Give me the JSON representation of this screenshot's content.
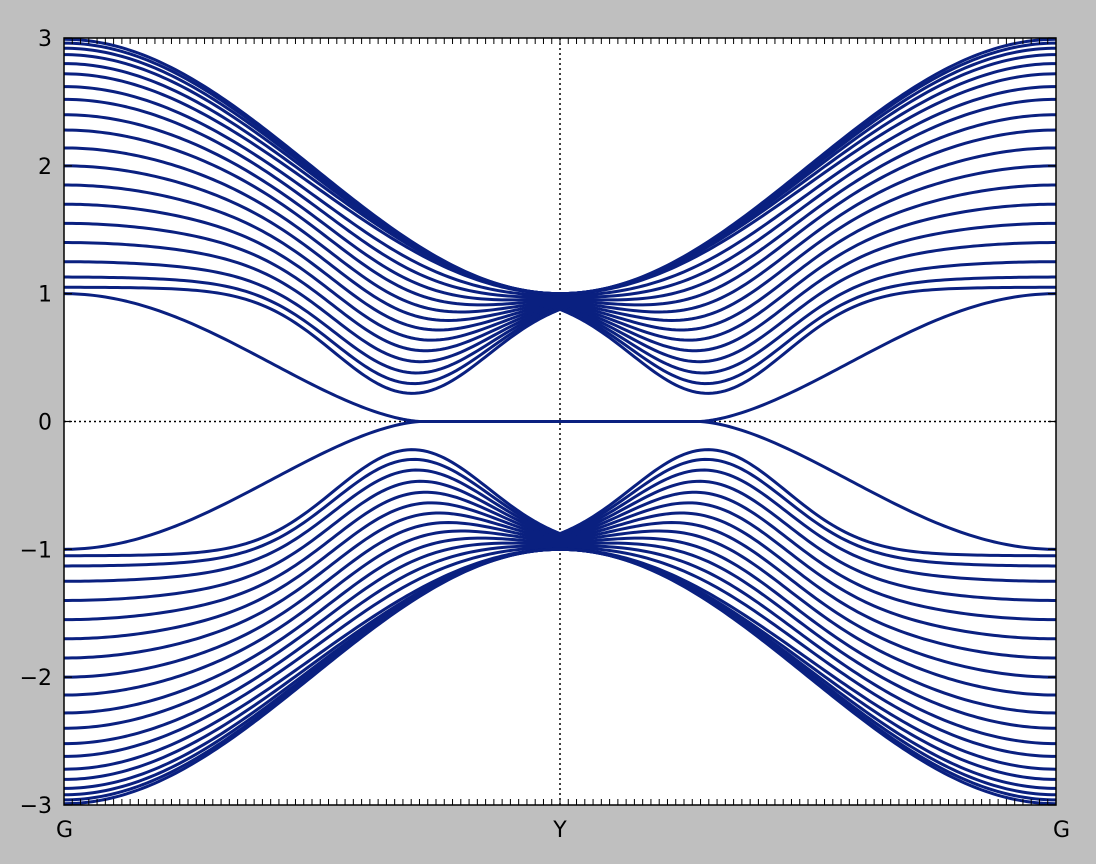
{
  "chart_data": {
    "type": "line",
    "title": "",
    "xlabel": "",
    "ylabel": "",
    "x_ticks": [
      "G",
      "Y",
      "G"
    ],
    "y_ticks": [
      "−3",
      "−2",
      "−1",
      "0",
      "1",
      "2",
      "3"
    ],
    "y_tick_values": [
      -3,
      -2,
      -1,
      0,
      1,
      2,
      3
    ],
    "xlim": [
      0,
      2
    ],
    "ylim": [
      -3,
      3
    ],
    "grid": "dotted lines at x = Y and y = 0",
    "legend": "none",
    "line_color": "#0a2080",
    "background_color": "#bfbfbf",
    "plot_background": "#ffffff",
    "bands": {
      "description": "Symmetric pairs of bands ±E(k) with E(G)=1…3 and E(Y)=1; two lowest bands form a flat zero-energy edge state near Y",
      "band_count_per_sign": 20,
      "gamma_energies": [
        1.0,
        1.05,
        1.13,
        1.25,
        1.4,
        1.55,
        1.7,
        1.85,
        2.0,
        2.14,
        2.28,
        2.4,
        2.52,
        2.62,
        2.72,
        2.8,
        2.87,
        2.92,
        2.96,
        2.99
      ],
      "y_point_energy": 1.0,
      "edge_state_flat_range": [
        0.72,
        1.28
      ]
    }
  }
}
